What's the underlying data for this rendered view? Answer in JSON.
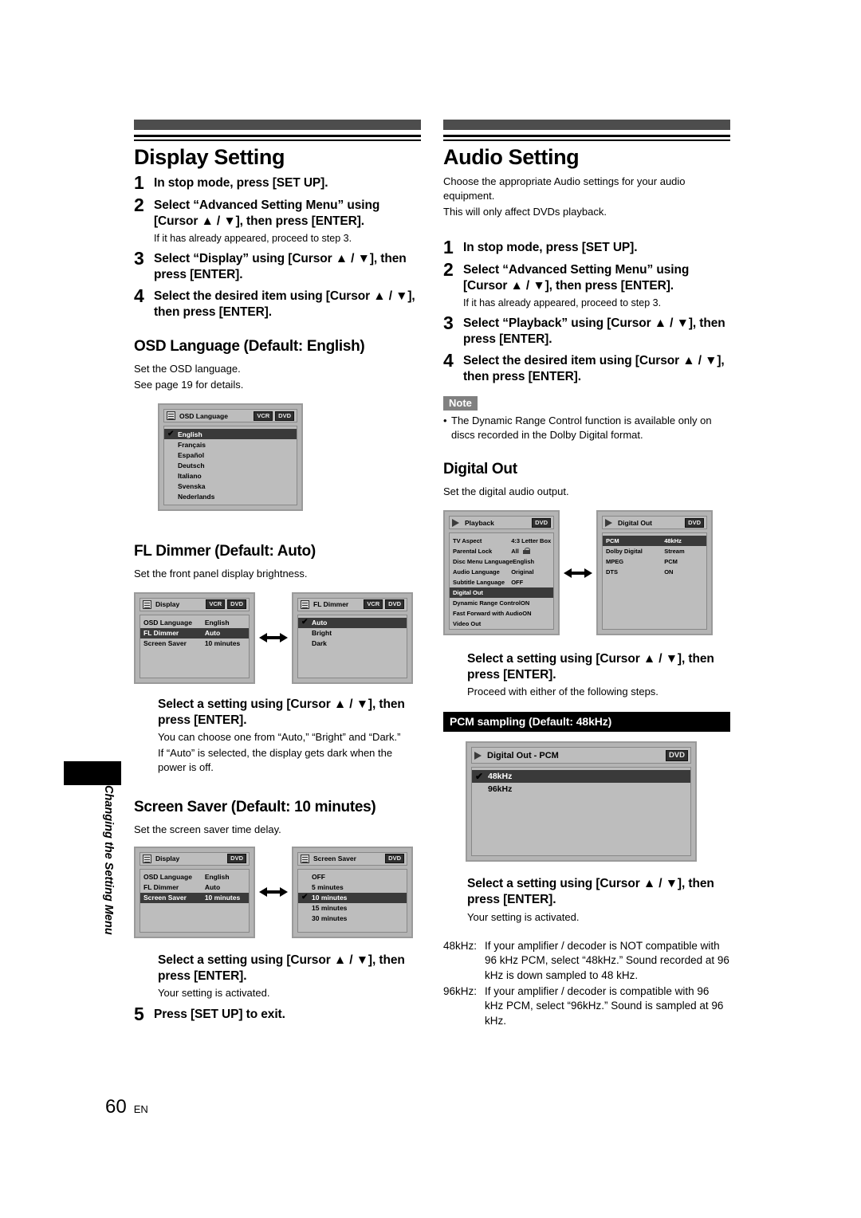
{
  "page": {
    "number": "60",
    "locale": "EN",
    "side_tab_label": "Changing the Setting Menu"
  },
  "left_column": {
    "section_title": "Display Setting",
    "steps": [
      {
        "num": "1",
        "text": "In stop mode, press [SET UP].",
        "note": ""
      },
      {
        "num": "2",
        "text": "Select “Advanced Setting Menu” using [Cursor ▲ / ▼], then press [ENTER].",
        "note": "If it has already appeared, proceed to step 3."
      },
      {
        "num": "3",
        "text": "Select “Display” using [Cursor ▲ / ▼], then press [ENTER].",
        "note": ""
      },
      {
        "num": "4",
        "text": "Select the desired item using [Cursor ▲ / ▼], then press [ENTER].",
        "note": ""
      }
    ],
    "osd_language": {
      "heading": "OSD Language (Default: English)",
      "desc_line1": "Set the OSD language.",
      "desc_line2": "See page 19 for details.",
      "shot": {
        "title": "OSD Language",
        "badges": [
          "VCR",
          "DVD"
        ],
        "rows": [
          {
            "label": "English",
            "value": "",
            "selected": true,
            "checked": true
          },
          {
            "label": "Français",
            "value": "",
            "selected": false,
            "checked": false
          },
          {
            "label": "Español",
            "value": "",
            "selected": false,
            "checked": false
          },
          {
            "label": "Deutsch",
            "value": "",
            "selected": false,
            "checked": false
          },
          {
            "label": "Italiano",
            "value": "",
            "selected": false,
            "checked": false
          },
          {
            "label": "Svenska",
            "value": "",
            "selected": false,
            "checked": false
          },
          {
            "label": "Nederlands",
            "value": "",
            "selected": false,
            "checked": false
          }
        ]
      }
    },
    "fl_dimmer": {
      "heading": "FL Dimmer (Default: Auto)",
      "desc": "Set the front panel display brightness.",
      "shot_left": {
        "title": "Display",
        "badges": [
          "VCR",
          "DVD"
        ],
        "rows": [
          {
            "label": "OSD Language",
            "value": "English",
            "selected": false,
            "checked": false
          },
          {
            "label": "FL Dimmer",
            "value": "Auto",
            "selected": true,
            "checked": false
          },
          {
            "label": "Screen Saver",
            "value": "10 minutes",
            "selected": false,
            "checked": false
          }
        ]
      },
      "shot_right": {
        "title": "FL Dimmer",
        "badges": [
          "VCR",
          "DVD"
        ],
        "rows": [
          {
            "label": "Auto",
            "value": "",
            "selected": true,
            "checked": true
          },
          {
            "label": "Bright",
            "value": "",
            "selected": false,
            "checked": false
          },
          {
            "label": "Dark",
            "value": "",
            "selected": false,
            "checked": false
          }
        ]
      },
      "instruct": "Select a setting using [Cursor ▲ / ▼], then press [ENTER].",
      "note1": "You can choose one from “Auto,” “Bright” and “Dark.”",
      "note2": "If “Auto” is selected, the display gets dark when the power is off."
    },
    "screen_saver": {
      "heading": "Screen Saver (Default: 10 minutes)",
      "desc": "Set the screen saver time delay.",
      "shot_left": {
        "title": "Display",
        "badges": [
          "DVD"
        ],
        "rows": [
          {
            "label": "OSD Language",
            "value": "English",
            "selected": false,
            "checked": false
          },
          {
            "label": "FL Dimmer",
            "value": "Auto",
            "selected": false,
            "checked": false
          },
          {
            "label": "Screen Saver",
            "value": "10 minutes",
            "selected": true,
            "checked": false
          }
        ]
      },
      "shot_right": {
        "title": "Screen Saver",
        "badges": [
          "DVD"
        ],
        "rows": [
          {
            "label": "OFF",
            "value": "",
            "selected": false,
            "checked": false
          },
          {
            "label": "5 minutes",
            "value": "",
            "selected": false,
            "checked": false
          },
          {
            "label": "10 minutes",
            "value": "",
            "selected": true,
            "checked": true
          },
          {
            "label": "15 minutes",
            "value": "",
            "selected": false,
            "checked": false
          },
          {
            "label": "30 minutes",
            "value": "",
            "selected": false,
            "checked": false
          }
        ]
      },
      "instruct": "Select a setting using [Cursor ▲ / ▼], then press [ENTER].",
      "note": "Your setting is activated."
    },
    "final_step": {
      "num": "5",
      "text": "Press [SET UP] to exit."
    }
  },
  "right_column": {
    "section_title": "Audio Setting",
    "intro_line1": "Choose the appropriate Audio settings for your audio equipment.",
    "intro_line2": "This will only affect DVDs playback.",
    "steps": [
      {
        "num": "1",
        "text": "In stop mode, press [SET UP].",
        "note": ""
      },
      {
        "num": "2",
        "text": "Select “Advanced Setting Menu” using [Cursor ▲ / ▼], then press [ENTER].",
        "note": "If it has already appeared, proceed to step 3."
      },
      {
        "num": "3",
        "text": "Select “Playback” using [Cursor ▲ / ▼], then press [ENTER].",
        "note": ""
      },
      {
        "num": "4",
        "text": "Select the desired item using [Cursor ▲ / ▼], then press [ENTER].",
        "note": ""
      }
    ],
    "note": {
      "tag": "Note",
      "items": [
        "The Dynamic Range Control function is available only on discs recorded in the Dolby Digital format."
      ]
    },
    "digital_out": {
      "heading": "Digital Out",
      "desc": "Set the digital audio output.",
      "shot_left": {
        "title": "Playback",
        "badges": [
          "DVD"
        ],
        "rows": [
          {
            "label": "TV Aspect",
            "value": "4:3 Letter Box",
            "selected": false,
            "checked": false,
            "lock": false
          },
          {
            "label": "Parental Lock",
            "value": "All",
            "selected": false,
            "checked": false,
            "lock": true
          },
          {
            "label": "Disc Menu Language",
            "value": "English",
            "selected": false,
            "checked": false,
            "lock": false
          },
          {
            "label": "Audio Language",
            "value": "Original",
            "selected": false,
            "checked": false,
            "lock": false
          },
          {
            "label": "Subtitle Language",
            "value": "OFF",
            "selected": false,
            "checked": false,
            "lock": false
          },
          {
            "label": "Digital Out",
            "value": "",
            "selected": true,
            "checked": false,
            "lock": false
          },
          {
            "label": "Dynamic Range Control",
            "value": "ON",
            "selected": false,
            "checked": false,
            "lock": false
          },
          {
            "label": "Fast Forward with Audio",
            "value": "ON",
            "selected": false,
            "checked": false,
            "lock": false
          },
          {
            "label": "Video Out",
            "value": "",
            "selected": false,
            "checked": false,
            "lock": false
          }
        ]
      },
      "shot_right": {
        "title": "Digital Out",
        "badges": [
          "DVD"
        ],
        "rows": [
          {
            "label": "PCM",
            "value": "48kHz",
            "selected": true,
            "checked": false
          },
          {
            "label": "Dolby Digital",
            "value": "Stream",
            "selected": false,
            "checked": false
          },
          {
            "label": "MPEG",
            "value": "PCM",
            "selected": false,
            "checked": false
          },
          {
            "label": "DTS",
            "value": "ON",
            "selected": false,
            "checked": false
          }
        ]
      },
      "instruct": "Select a setting using [Cursor ▲ / ▼], then press [ENTER].",
      "note": "Proceed with either of the following steps."
    },
    "pcm_sampling": {
      "banner": "PCM sampling (Default: 48kHz)",
      "shot": {
        "title": "Digital Out - PCM",
        "badges": [
          "DVD"
        ],
        "rows": [
          {
            "label": "48kHz",
            "value": "",
            "selected": true,
            "checked": true
          },
          {
            "label": "96kHz",
            "value": "",
            "selected": false,
            "checked": false
          }
        ]
      },
      "instruct": "Select a setting using [Cursor ▲ / ▼], then press [ENTER].",
      "note": "Your setting is activated.",
      "definitions": [
        {
          "term": "48kHz:",
          "desc": "If your amplifier / decoder is NOT compatible with 96 kHz PCM, select “48kHz.” Sound recorded at 96 kHz is down sampled to 48 kHz."
        },
        {
          "term": "96kHz:",
          "desc": "If your amplifier / decoder is compatible with 96 kHz PCM, select “96kHz.” Sound is sampled at 96 kHz."
        }
      ]
    }
  }
}
